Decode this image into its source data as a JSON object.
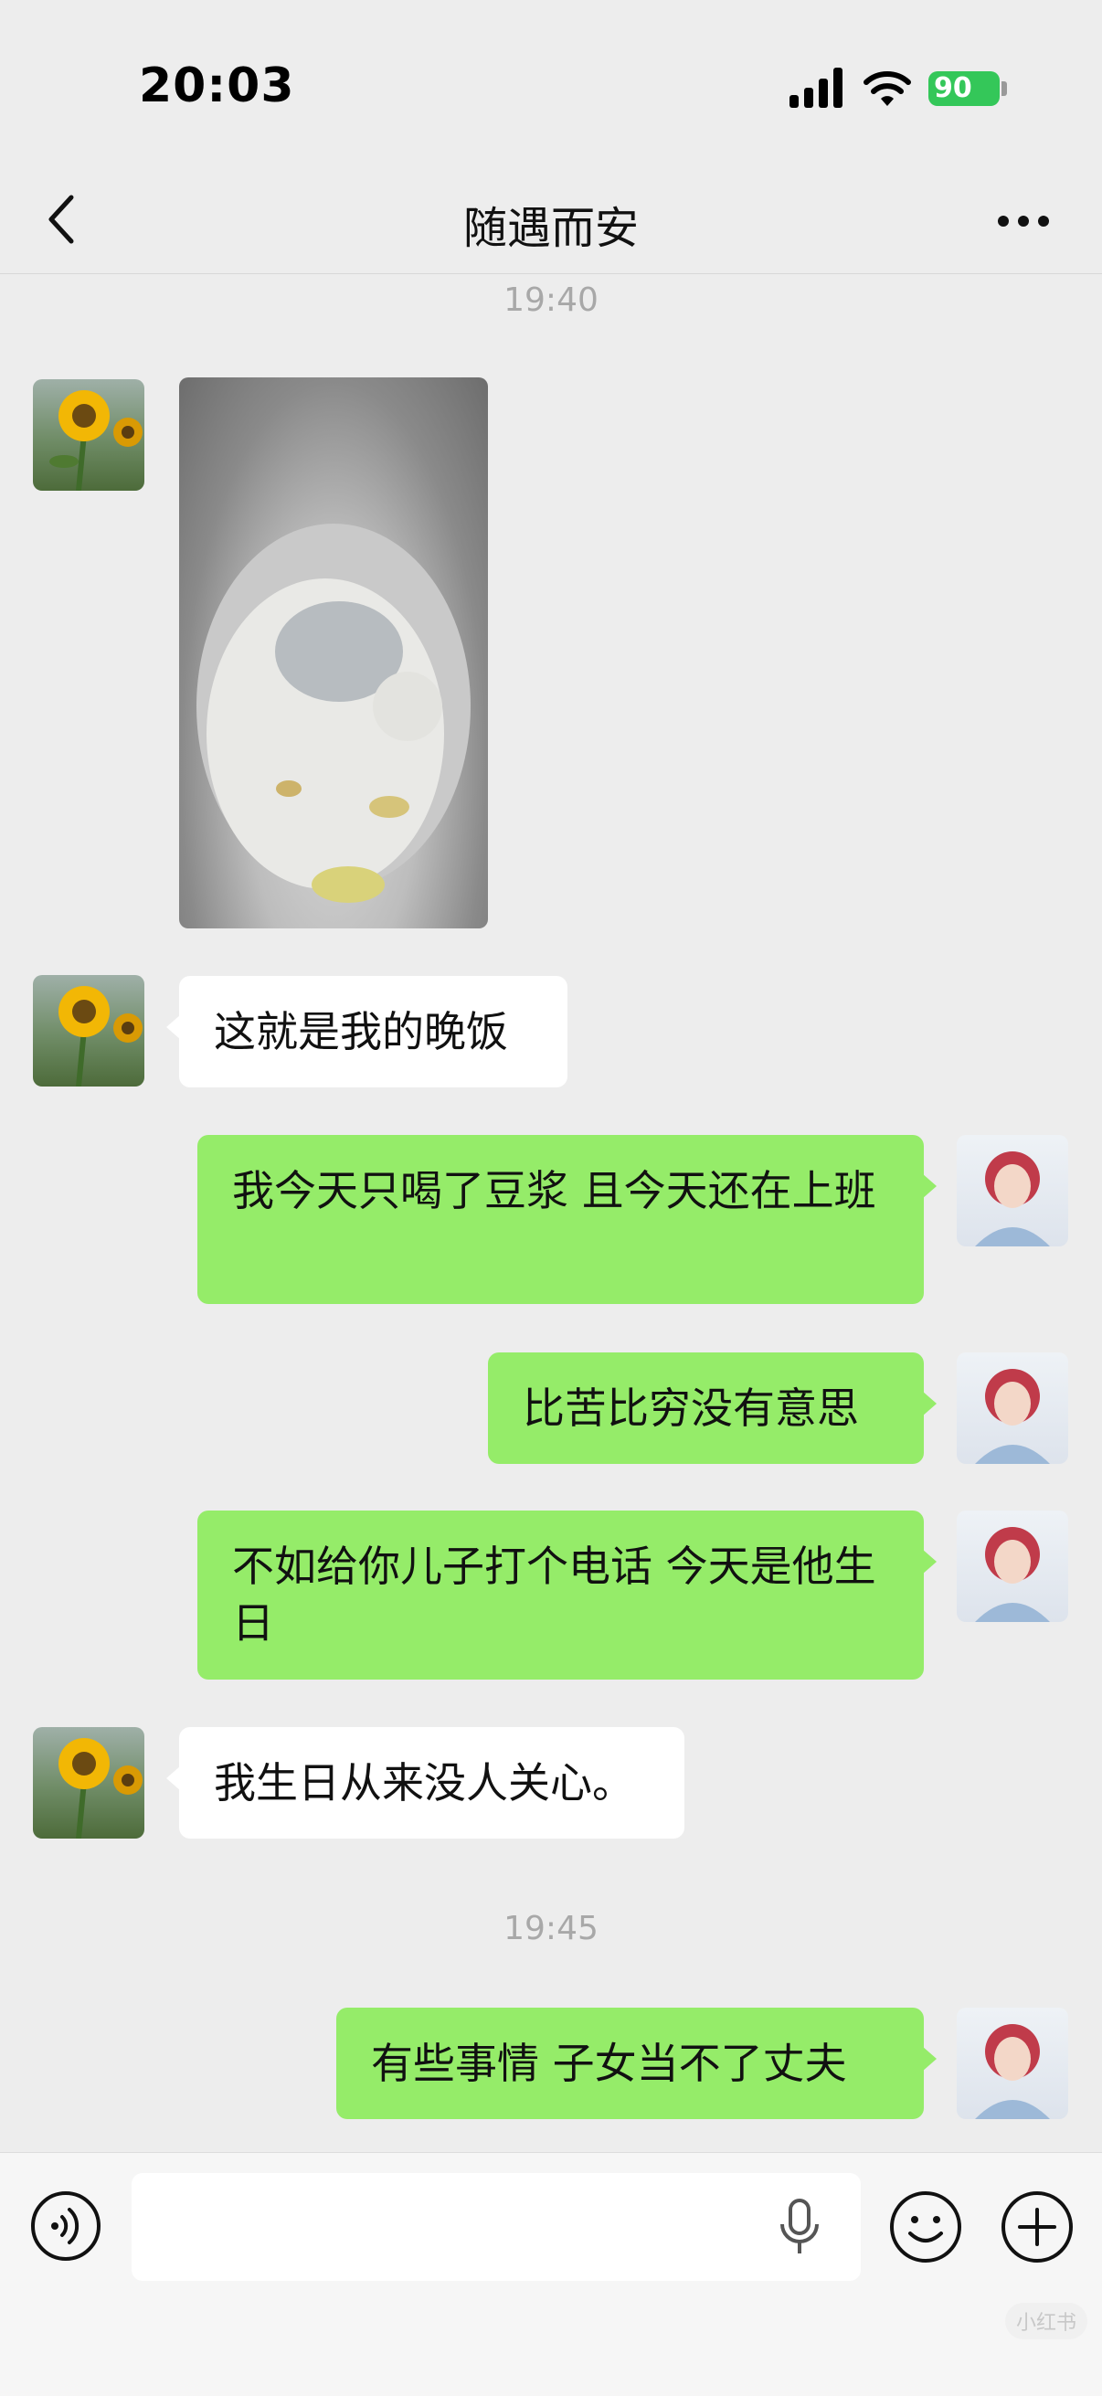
{
  "status": {
    "time": "20:03",
    "battery": "90"
  },
  "header": {
    "title": "随遇而安"
  },
  "messages": {
    "ts1": "19:40",
    "m_left_1": "这就是我的晚饭",
    "m_right_1": "我今天只喝了豆浆 且今天还在上班",
    "m_right_2": "比苦比穷没有意思",
    "m_right_3": "不如给你儿子打个电话 今天是他生日",
    "m_left_2": "我生日从来没人关心。",
    "ts2": "19:45",
    "m_right_4": "有些事情 子女当不了丈夫"
  },
  "input": {
    "value": ""
  },
  "watermark": "小红书",
  "colors": {
    "bubble_sent": "#95ec69",
    "bubble_received": "#ffffff",
    "background": "#ededed"
  },
  "icons": [
    "back-icon",
    "more-icon",
    "voice-icon",
    "microphone-icon",
    "emoji-icon",
    "plus-icon"
  ]
}
